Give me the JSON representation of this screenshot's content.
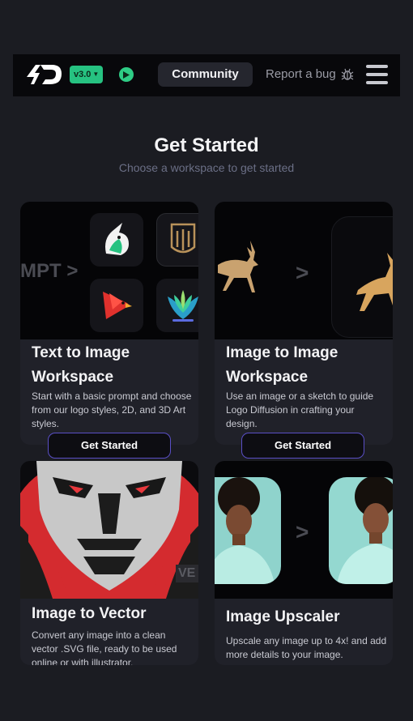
{
  "nav": {
    "version_label": "v3.0",
    "community_label": "Community",
    "report_label": "Report a bug"
  },
  "page": {
    "title": "Get Started",
    "subtitle": "Choose a workspace to get started"
  },
  "cards": [
    {
      "title": "Text to Image Workspace",
      "description": "Start with a basic prompt and choose from our logo styles, 2D, and 3D Art styles.",
      "button_label": "Get Started",
      "media_text": "MPT >"
    },
    {
      "title": "Image to Image Workspace",
      "description": "Use an image or a sketch to guide Logo Diffusion in crafting your design.",
      "button_label": "Get Started",
      "media_text": ">"
    },
    {
      "title": "Image to Vector",
      "description": "Convert any image into a clean vector .SVG file, ready to be used online or with illustrator.",
      "media_text": "VE"
    },
    {
      "title": "Image Upscaler",
      "description": "Upscale any image up to 4x! and add more details to your image.",
      "media_text": ">"
    }
  ],
  "colors": {
    "background": "#1b1c22",
    "nav": "#08080b",
    "accent_green": "#26c281",
    "button_border": "#5a4fc6"
  }
}
